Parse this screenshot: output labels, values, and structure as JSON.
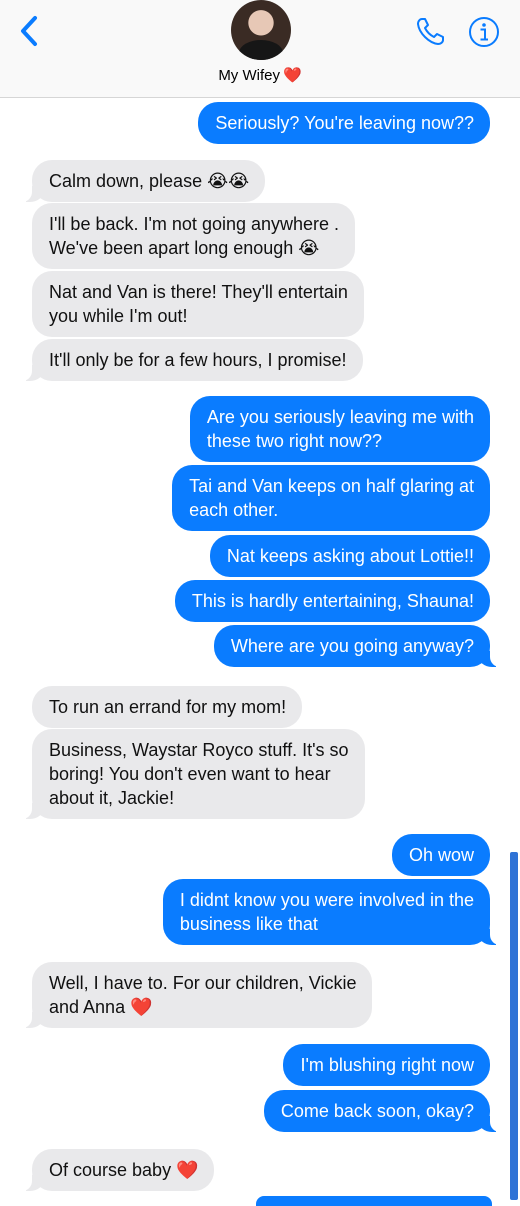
{
  "header": {
    "contact_name": "My Wifey",
    "contact_emoji": "❤️",
    "back_icon": "chevron-left-icon",
    "phone_icon": "phone-icon",
    "info_icon": "info-icon",
    "accent_color": "#0a7cff"
  },
  "messages": [
    {
      "dir": "out",
      "text": "Seriously? You're leaving now??"
    },
    {
      "dir": "in",
      "text": "Calm down, please 😭😭"
    },
    {
      "dir": "in",
      "text": "I'll be back. I'm not going anywhere .\nWe've been apart long enough 😭"
    },
    {
      "dir": "in",
      "text": "Nat and Van is there! They'll entertain\nyou while I'm out!"
    },
    {
      "dir": "in",
      "text": "It'll only be for a few hours, I promise!"
    },
    {
      "dir": "out",
      "text": "Are you seriously leaving me with\nthese two right now??"
    },
    {
      "dir": "out",
      "text": "Tai and Van keeps on half glaring at\neach other."
    },
    {
      "dir": "out",
      "text": "Nat keeps asking about Lottie!!"
    },
    {
      "dir": "out",
      "text": "This is hardly entertaining, Shauna!"
    },
    {
      "dir": "out",
      "text": "Where are you going anyway?"
    },
    {
      "dir": "in",
      "text": "To run an errand for my mom!"
    },
    {
      "dir": "in",
      "text": "Business, Waystar Royco stuff. It's so\nboring! You don't even want to hear\nabout it, Jackie!"
    },
    {
      "dir": "out",
      "text": "Oh wow"
    },
    {
      "dir": "out",
      "text": "I didnt know you were involved in the\nbusiness like that"
    },
    {
      "dir": "in",
      "text": "Well, I have to. For our children, Vickie\nand Anna ❤️"
    },
    {
      "dir": "out",
      "text": "I'm blushing right now"
    },
    {
      "dir": "out",
      "text": "Come back soon, okay?"
    },
    {
      "dir": "in",
      "text": "Of course baby ❤️"
    }
  ]
}
